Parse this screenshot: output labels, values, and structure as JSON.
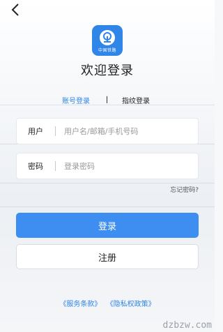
{
  "header": {
    "back_icon": "chevron-left-icon"
  },
  "logo": {
    "text": "中国铁路",
    "color": "#2f86e8"
  },
  "title": "欢迎登录",
  "tabs": {
    "account": "账号登录",
    "fingerprint": "指纹登录",
    "active_color": "#2f86e8"
  },
  "form": {
    "user_label": "用户",
    "user_placeholder": "用户名/邮箱/手机号码",
    "password_label": "密码",
    "password_placeholder": "登录密码",
    "forgot": "忘记密码?"
  },
  "buttons": {
    "login": "登录",
    "register": "注册",
    "login_color": "#3d8ef0"
  },
  "links": {
    "terms": "《服务条款》",
    "privacy": "《隐私权政策》"
  },
  "watermark": "dzbzw.com"
}
